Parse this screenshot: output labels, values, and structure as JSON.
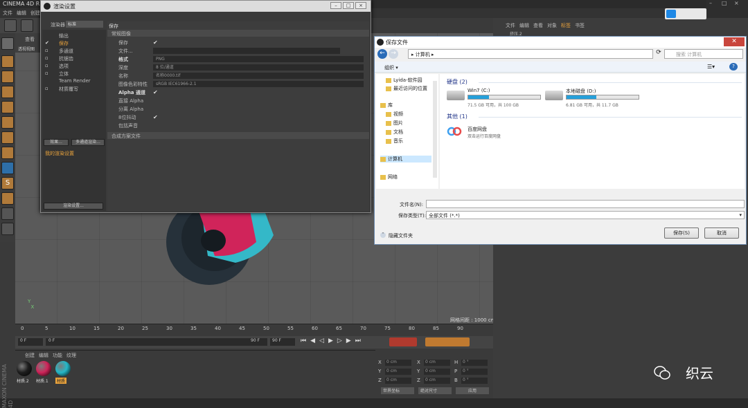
{
  "app": {
    "title": "CINEMA 4D R"
  },
  "main_menu": [
    "文件",
    "编辑",
    "创建"
  ],
  "viewport": {
    "menu": "查看",
    "label": "透视视图",
    "grid_info": "网格间距 : 1000 cm"
  },
  "right_panel": {
    "menu": [
      "文件",
      "编辑",
      "查看",
      "对象",
      "标签",
      "书签"
    ],
    "object": "挤压.2"
  },
  "timeline": {
    "ticks": [
      "0",
      "5",
      "10",
      "15",
      "20",
      "25",
      "30",
      "35",
      "40",
      "45",
      "50",
      "55",
      "60",
      "65",
      "70",
      "75",
      "80",
      "85",
      "90"
    ],
    "current": "0 F",
    "start": "0 F",
    "end": "90 F",
    "end2": "90 F"
  },
  "materials": {
    "tabs": [
      "创建",
      "编辑",
      "功能",
      "纹理"
    ],
    "items": [
      {
        "label": "材质.2",
        "color": "#1e1e1e"
      },
      {
        "label": "材质.1",
        "color": "#d0245a"
      },
      {
        "label": "材质",
        "color": "#24b8c8"
      }
    ]
  },
  "coords": {
    "rows": [
      {
        "a": "X",
        "av": "0 cm",
        "b": "X",
        "bv": "0 cm",
        "c": "H",
        "cv": "0 °"
      },
      {
        "a": "Y",
        "av": "0 cm",
        "b": "Y",
        "bv": "0 cm",
        "c": "P",
        "cv": "0 °"
      },
      {
        "a": "Z",
        "av": "0 cm",
        "b": "Z",
        "bv": "0 cm",
        "c": "B",
        "cv": "0 °"
      }
    ],
    "world": "世界坐标",
    "scale": "绝对尺寸",
    "apply": "应用"
  },
  "render_settings": {
    "title": "渲染设置",
    "renderer_label": "渲染器",
    "renderer_value": "标准",
    "tree": [
      "输出",
      "保存",
      "多通道",
      "抗锯齿",
      "选项",
      "立体",
      "Team Render",
      "材质覆写"
    ],
    "effects_btn": "效果...",
    "multipass_btn": "多通道渲染...",
    "my_settings": "我的渲染设置",
    "bottom_btn": "渲染设置...",
    "section": "保存",
    "group": "常规图像",
    "rows": [
      {
        "label": "保存",
        "value": "✔",
        "type": "check"
      },
      {
        "label": "文件...",
        "value": "",
        "type": "field"
      },
      {
        "label": "格式",
        "value": "PNG",
        "type": "field"
      },
      {
        "label": "深度",
        "value": "8 位/通道",
        "type": "field"
      },
      {
        "label": "名称",
        "value": "名称0000.tif",
        "type": "field"
      },
      {
        "label": "图像色彩特性",
        "value": "sRGB IEC61966-2.1",
        "type": "field"
      },
      {
        "label": "Alpha 通道",
        "value": "✔",
        "type": "check"
      },
      {
        "label": "直接 Alpha",
        "value": "",
        "type": "check"
      },
      {
        "label": "分离 Alpha",
        "value": "",
        "type": "check"
      },
      {
        "label": "8位抖动",
        "value": "✔",
        "type": "check"
      },
      {
        "label": "包括声音",
        "value": "",
        "type": "check"
      }
    ],
    "composite": "合成方案文件"
  },
  "save_dialog": {
    "title": "保存文件",
    "address": "计算机",
    "search_placeholder": "搜索 计算机",
    "organize": "组织 ▾",
    "nav": [
      "Lyida-软件园",
      "最近访问的位置",
      "库",
      "视频",
      "图片",
      "文档",
      "音乐",
      "计算机",
      "网络"
    ],
    "group_disks": "硬盘 (2)",
    "group_other": "其他 (1)",
    "drives": [
      {
        "name": "Win7 (C:)",
        "info": "71.5 GB 可用，共 100 GB",
        "used": 0.285
      },
      {
        "name": "本地磁盘 (D:)",
        "info": "6.81 GB 可用，共 11.7 GB",
        "used": 0.418
      }
    ],
    "other_item": {
      "name": "百度网盘",
      "desc": "双击运行百度网盘"
    },
    "filename_label": "文件名(N):",
    "filename_value": "",
    "type_label": "保存类型(T):",
    "type_value": "全部文件 (*.*)",
    "hide_folders": "隐藏文件夹",
    "save_btn": "保存(S)",
    "cancel_btn": "取消"
  },
  "watermark": "织云"
}
